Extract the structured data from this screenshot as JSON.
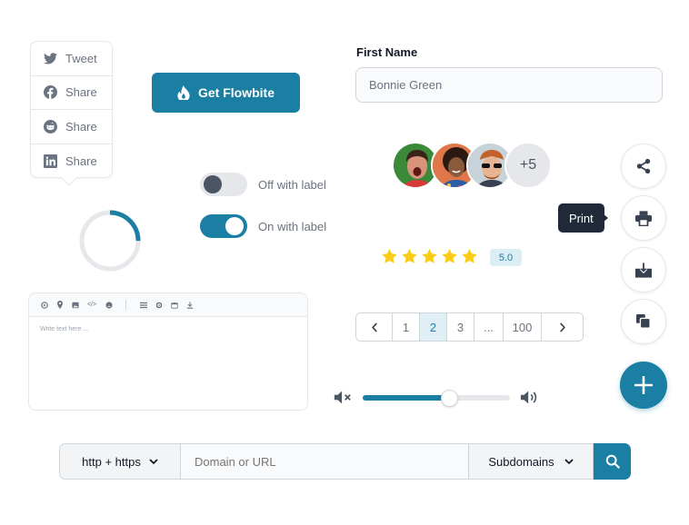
{
  "share_list": {
    "items": [
      {
        "label": "Tweet",
        "icon": "twitter-icon"
      },
      {
        "label": "Share",
        "icon": "facebook-icon"
      },
      {
        "label": "Share",
        "icon": "reddit-icon"
      },
      {
        "label": "Share",
        "icon": "linkedin-icon"
      }
    ]
  },
  "cta": {
    "label": "Get Flowbite",
    "icon": "fire-icon"
  },
  "toggles": {
    "off_label": "Off with label",
    "on_label": "On with label",
    "off_checked": false,
    "on_checked": true
  },
  "spinner": {
    "progress": 0.25
  },
  "editor": {
    "placeholder": "Write text here ...",
    "toolbar_icons": [
      "paperclip-icon",
      "map-pin-icon",
      "image-icon",
      "code-icon",
      "emoji-icon",
      "list-icon",
      "gear-icon",
      "calendar-icon",
      "download-icon"
    ]
  },
  "form": {
    "label": "First Name",
    "value": "Bonnie Green"
  },
  "avatars": {
    "count": 3,
    "more_label": "+5"
  },
  "rating": {
    "stars": 5,
    "max": 5,
    "value_label": "5.0"
  },
  "pagination": {
    "prev": "‹",
    "next": "›",
    "pages": [
      "1",
      "2",
      "3",
      "...",
      "100"
    ],
    "active": "2"
  },
  "volume": {
    "level": 0.59,
    "mute_icon": "volume-mute-icon",
    "up_icon": "volume-up-icon"
  },
  "speed_dial": {
    "tooltip": "Print",
    "actions": [
      "share-icon",
      "printer-icon",
      "download-icon",
      "copy-icon"
    ],
    "main_icon": "plus-icon"
  },
  "search": {
    "protocol": "http + https",
    "placeholder": "Domain or URL",
    "subdomains": "Subdomains"
  },
  "colors": {
    "primary": "#1a7fa3",
    "star": "#facc15",
    "tooltip_bg": "#1f2937"
  }
}
